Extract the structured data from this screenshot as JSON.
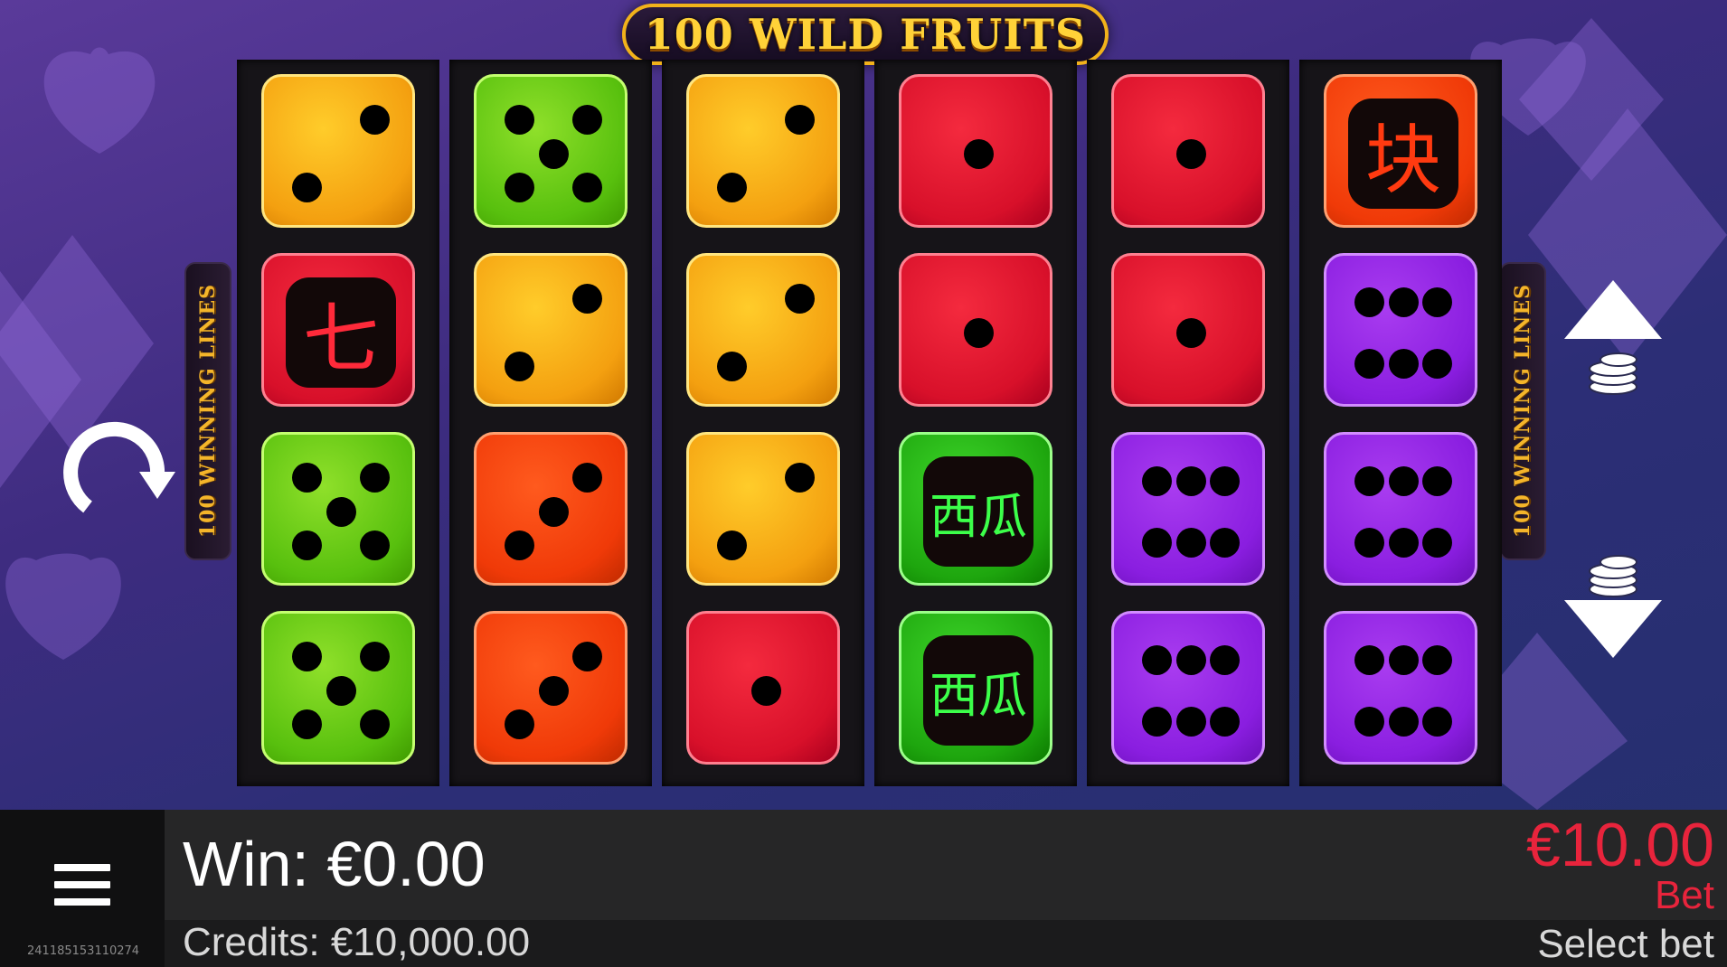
{
  "game": {
    "title": "100 WILD FRUITS",
    "side_banner": "100 WINNING LINES"
  },
  "colors": {
    "yellow": "#f4a010",
    "green": "#58c00e",
    "red": "#d8102a",
    "orange": "#f03a08",
    "purple": "#8a1ee0",
    "dark_green": "#1ea60e",
    "bet_accent": "#e8243c"
  },
  "grid": {
    "reels": [
      [
        {
          "type": "die",
          "color": "yellow",
          "pips": 2
        },
        {
          "type": "symbol",
          "color": "red",
          "glyph": "七",
          "glyph_color": "#ff2a3a"
        },
        {
          "type": "die",
          "color": "green",
          "pips": 5
        },
        {
          "type": "die",
          "color": "green",
          "pips": 5
        }
      ],
      [
        {
          "type": "die",
          "color": "green",
          "pips": 5
        },
        {
          "type": "die",
          "color": "yellow",
          "pips": 2
        },
        {
          "type": "die",
          "color": "orange",
          "pips": 3
        },
        {
          "type": "die",
          "color": "orange",
          "pips": 3
        }
      ],
      [
        {
          "type": "die",
          "color": "yellow",
          "pips": 2
        },
        {
          "type": "die",
          "color": "yellow",
          "pips": 2
        },
        {
          "type": "die",
          "color": "yellow",
          "pips": 2
        },
        {
          "type": "die",
          "color": "red",
          "pips": 1
        }
      ],
      [
        {
          "type": "die",
          "color": "red",
          "pips": 1
        },
        {
          "type": "die",
          "color": "red",
          "pips": 1
        },
        {
          "type": "symbol",
          "color": "dark_green",
          "glyph": "西瓜",
          "glyph_color": "#3cff4a"
        },
        {
          "type": "symbol",
          "color": "dark_green",
          "glyph": "西瓜",
          "glyph_color": "#3cff4a"
        }
      ],
      [
        {
          "type": "die",
          "color": "red",
          "pips": 1
        },
        {
          "type": "die",
          "color": "red",
          "pips": 1
        },
        {
          "type": "die",
          "color": "purple",
          "pips": 6
        },
        {
          "type": "die",
          "color": "purple",
          "pips": 6
        }
      ],
      [
        {
          "type": "symbol",
          "color": "orange",
          "glyph": "块",
          "glyph_color": "#ff3a10"
        },
        {
          "type": "die",
          "color": "purple",
          "pips": 6
        },
        {
          "type": "die",
          "color": "purple",
          "pips": 6
        },
        {
          "type": "die",
          "color": "purple",
          "pips": 6
        }
      ]
    ]
  },
  "controls": {
    "autoplay_icon": "autoplay-icon",
    "bet_up_icon": "bet-up-icon",
    "bet_down_icon": "bet-down-icon",
    "menu_icon": "menu-icon"
  },
  "footer": {
    "win_text": "Win: €0.00",
    "credits_text": "Credits: €10,000.00",
    "bet_value": "€10.00",
    "bet_label": "Bet",
    "select_bet": "Select bet",
    "session_id": "241185153110274"
  }
}
